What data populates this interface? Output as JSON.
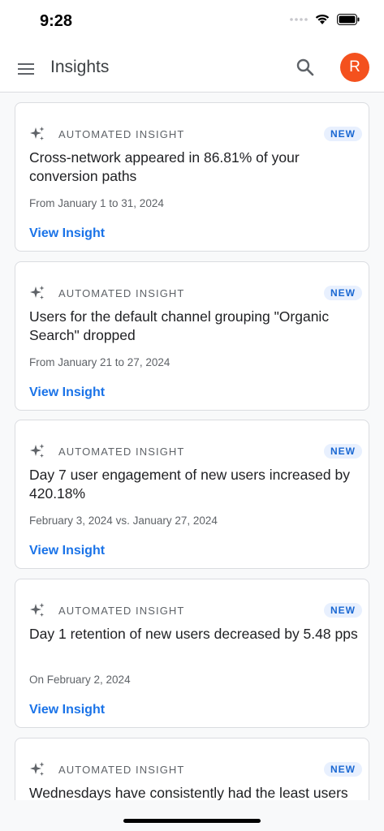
{
  "status_bar": {
    "time": "9:28"
  },
  "app_bar": {
    "title": "Insights",
    "avatar_initial": "R"
  },
  "cards": [
    {
      "kicker": "AUTOMATED INSIGHT",
      "badge": "NEW",
      "title": "Cross-network appeared in 86.81% of your conversion paths",
      "date": "From January 1 to 31, 2024",
      "link": "View Insight"
    },
    {
      "kicker": "AUTOMATED INSIGHT",
      "badge": "NEW",
      "title": "Users for the default channel grouping \"Organic Search\" dropped",
      "date": "From January 21 to 27, 2024",
      "link": "View Insight"
    },
    {
      "kicker": "AUTOMATED INSIGHT",
      "badge": "NEW",
      "title": "Day 7 user engagement of new users increased by 420.18%",
      "date": "February 3, 2024 vs. January 27, 2024",
      "link": "View Insight"
    },
    {
      "kicker": "AUTOMATED INSIGHT",
      "badge": "NEW",
      "title": "Day 1 retention of new users decreased by 5.48 pps",
      "date": "On February 2, 2024",
      "link": "View Insight"
    },
    {
      "kicker": "AUTOMATED INSIGHT",
      "badge": "NEW",
      "title": "Wednesdays have consistently had the least users",
      "date": "",
      "link": ""
    }
  ],
  "colors": {
    "accent": "#1a73e8",
    "avatar": "#f4511e",
    "badge_bg": "#e8f0fe"
  }
}
